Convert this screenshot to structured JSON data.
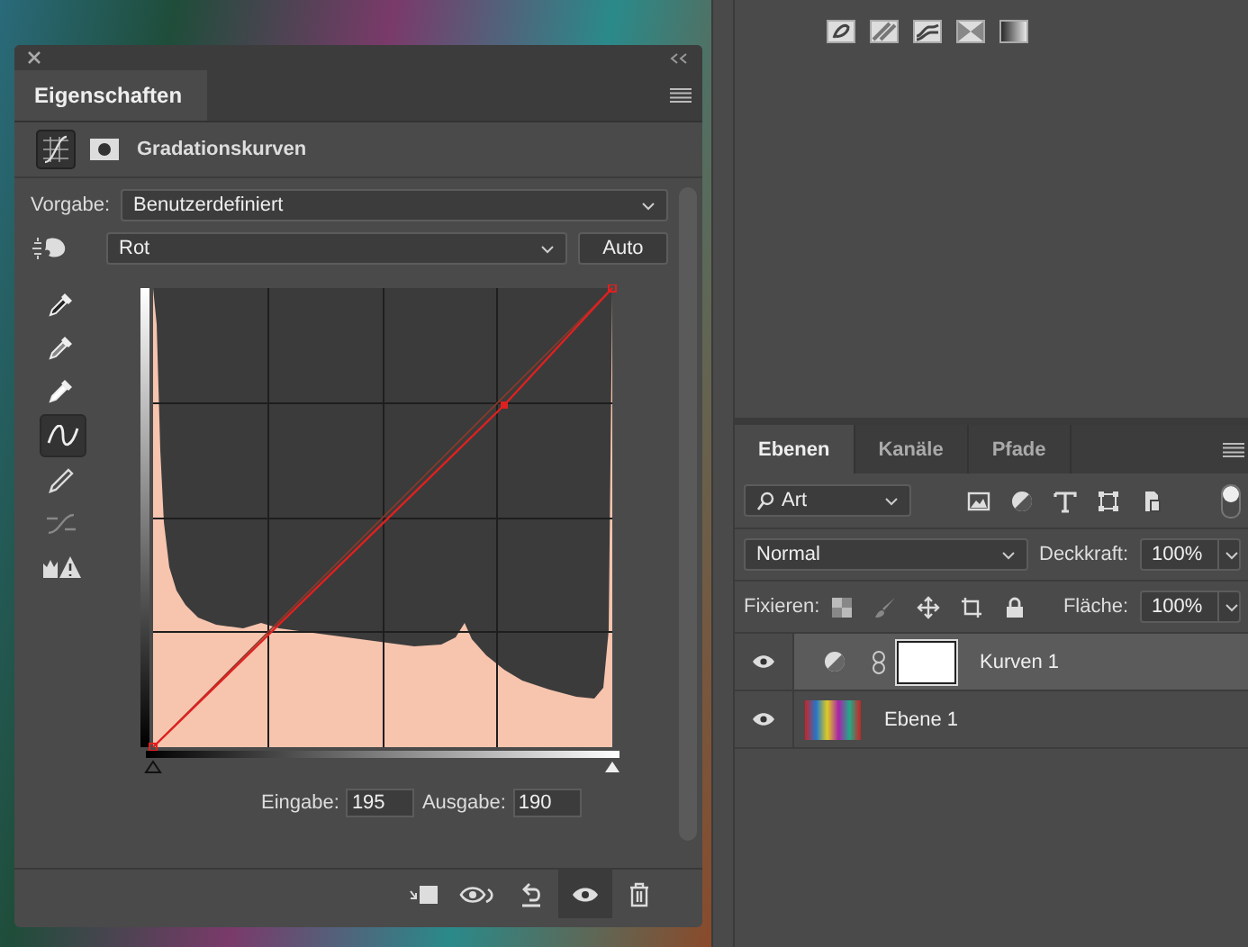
{
  "properties_panel": {
    "title": "Eigenschaften",
    "heading": "Gradationskurven",
    "preset_label": "Vorgabe:",
    "preset_value": "Benutzerdefiniert",
    "channel_value": "Rot",
    "auto_button": "Auto",
    "tools": [
      {
        "kind": "eyedropper-dark",
        "selected": false
      },
      {
        "kind": "eyedropper-mid",
        "selected": false
      },
      {
        "kind": "eyedropper-light",
        "selected": false
      },
      {
        "kind": "curve",
        "selected": true
      },
      {
        "kind": "pencil",
        "selected": false
      },
      {
        "kind": "smooth",
        "selected": false
      },
      {
        "kind": "clipping",
        "selected": false
      }
    ],
    "sliders": [
      {
        "level": 0
      },
      {
        "level": 1
      }
    ],
    "input_label": "Eingabe:",
    "input_value": "195",
    "output_label": "Ausgabe:",
    "output_value": "190",
    "footer_buttons": [
      {
        "kind": "clip",
        "selected": false
      },
      {
        "kind": "preview",
        "selected": false
      },
      {
        "kind": "reset",
        "selected": false
      },
      {
        "kind": "visibility",
        "selected": true
      },
      {
        "kind": "delete",
        "selected": false
      }
    ]
  },
  "top_panel": {
    "icons": [
      {
        "kind": "swirl"
      },
      {
        "kind": "stripes"
      },
      {
        "kind": "wave"
      },
      {
        "kind": "hourglass"
      },
      {
        "kind": "gradient"
      }
    ]
  },
  "layers_panel": {
    "tabs": [
      {
        "label": "Ebenen",
        "selected": true
      },
      {
        "label": "Kanäle",
        "selected": false
      },
      {
        "label": "Pfade",
        "selected": false
      }
    ],
    "filter_value": "Art",
    "filter_icons": [
      {
        "kind": "image"
      },
      {
        "kind": "adjustment"
      },
      {
        "kind": "text"
      },
      {
        "kind": "shape"
      },
      {
        "kind": "smart"
      }
    ],
    "filter_on": true,
    "blend_mode": "Normal",
    "opacity_label": "Deckkraft:",
    "opacity_value": "100%",
    "lock_label": "Fixieren:",
    "lock_icons": [
      {
        "kind": "pixels"
      },
      {
        "kind": "brush"
      },
      {
        "kind": "move"
      },
      {
        "kind": "artboard"
      },
      {
        "kind": "lock"
      }
    ],
    "fill_label": "Fläche:",
    "fill_value": "100%",
    "layers": [
      {
        "name": "Kurven 1",
        "kind": "adjustment",
        "selected": true,
        "visible": true
      },
      {
        "name": "Ebene 1",
        "kind": "image",
        "selected": false,
        "visible": true
      }
    ]
  }
}
